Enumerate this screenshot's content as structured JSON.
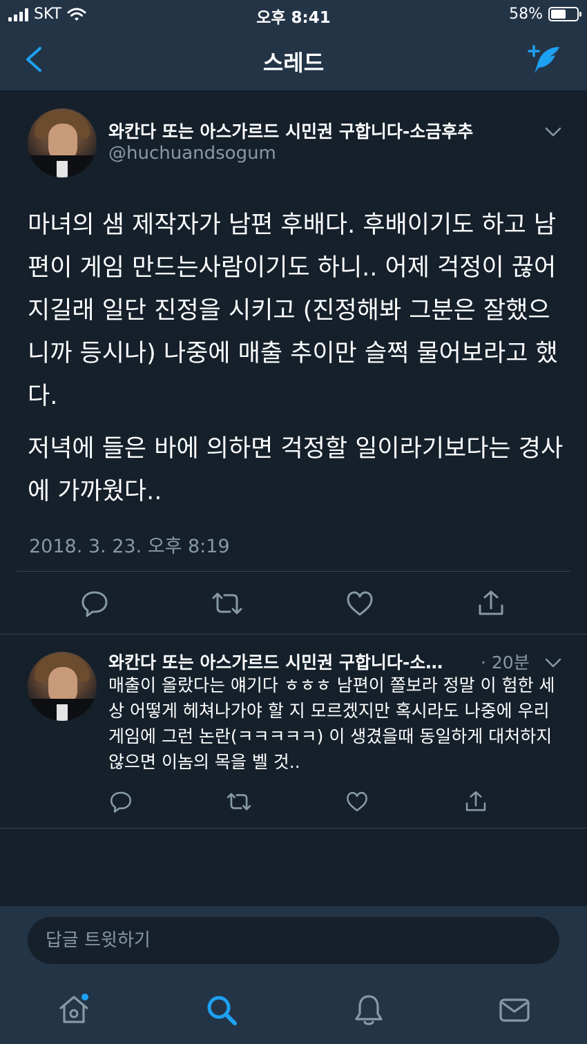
{
  "status_bar": {
    "carrier": "SKT",
    "time": "오후 8:41",
    "battery_percent": "58%",
    "battery_level": 0.58
  },
  "nav": {
    "title": "스레드"
  },
  "main_tweet": {
    "display_name": "와칸다 또는 아스가르드 시민권 구합니다-소금후추",
    "handle": "@huchuandsogum",
    "paragraphs": [
      "마녀의 샘 제작자가 남편 후배다. 후배이기도 하고 남편이 게임 만드는사람이기도 하니.. 어제 걱정이 끊어지길래 일단 진정을 시키고 (진정해봐 그분은 잘했으니까 등시나) 나중에 매출 추이만 슬쩍 물어보라고 했다.",
      "저녁에 들은 바에 의하면 걱정할 일이라기보다는 경사에 가까웠다.."
    ],
    "timestamp": "2018. 3. 23. 오후 8:19"
  },
  "reply_tweet": {
    "display_name": "와칸다 또는 아스가르드 시민권 구합니다-소…",
    "time": "· 20분",
    "text": "매출이 올랐다는 얘기다 ㅎㅎㅎ 남편이 쫄보라 정말 이 험한 세상 어떻게 헤쳐나가야 할 지 모르겠지만 혹시라도 나중에 우리 게임에 그런 논란(ㅋㅋㅋㅋㅋ) 이 생겼을때 동일하게 대처하지 않으면 이놈의 목을 벨 것.."
  },
  "composer": {
    "placeholder": "답글 트윗하기"
  },
  "tabs": [
    {
      "icon": "home-icon",
      "has_notification_dot": true
    },
    {
      "icon": "search-icon",
      "active": true
    },
    {
      "icon": "bell-icon"
    },
    {
      "icon": "mail-icon"
    }
  ],
  "colors": {
    "background": "#15202b",
    "bar_background": "#243447",
    "accent": "#1da1f2",
    "secondary_text": "#8899a6",
    "border": "#38444d"
  }
}
